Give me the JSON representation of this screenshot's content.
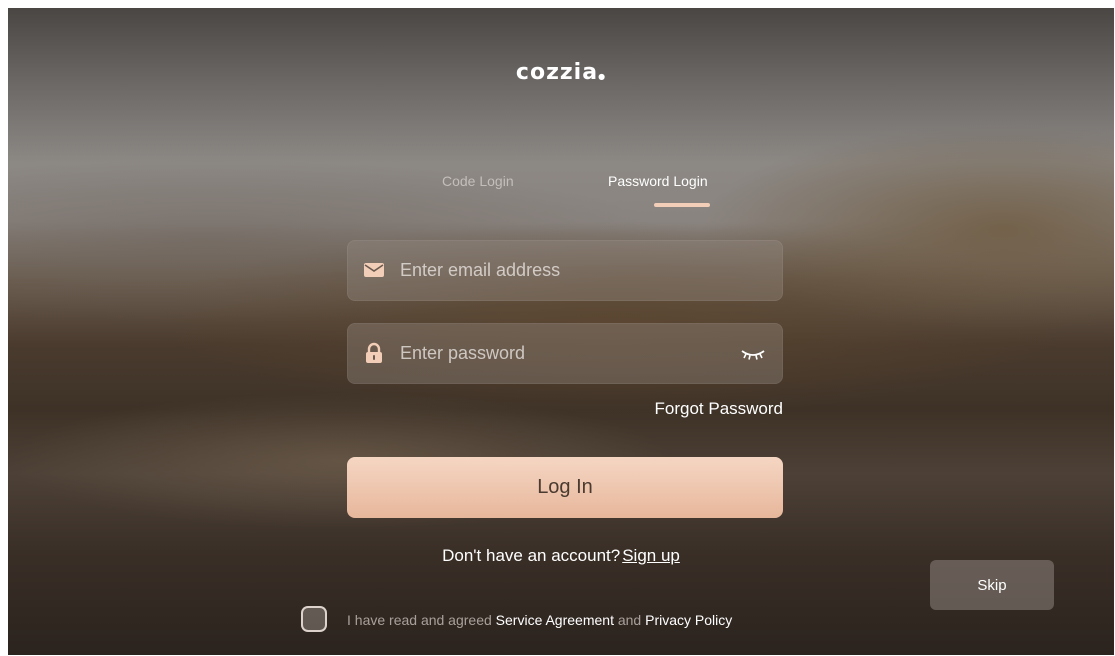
{
  "logo": {
    "text": "cozzia"
  },
  "tabs": [
    {
      "label": "Code Login",
      "active": false
    },
    {
      "label": "Password Login",
      "active": true
    }
  ],
  "email": {
    "placeholder": "Enter email address",
    "value": ""
  },
  "password": {
    "placeholder": "Enter password",
    "value": ""
  },
  "icons": {
    "email": "envelope-icon",
    "password": "lock-icon",
    "visibility": "eye-closed-icon"
  },
  "forgot_label": "Forgot Password",
  "login_label": "Log In",
  "signup": {
    "prompt": "Don't have an account?",
    "link": "Sign up"
  },
  "skip_label": "Skip",
  "agreement": {
    "checked": false,
    "prefix": "I have read and agreed",
    "service_link": "Service Agreement",
    "joiner": "and",
    "privacy_link": "Privacy Policy"
  },
  "colors": {
    "accent": "#f2cdb7",
    "button_top": "#f5d6c3",
    "button_bottom": "#e7b79b",
    "button_text": "#4a3a30"
  }
}
